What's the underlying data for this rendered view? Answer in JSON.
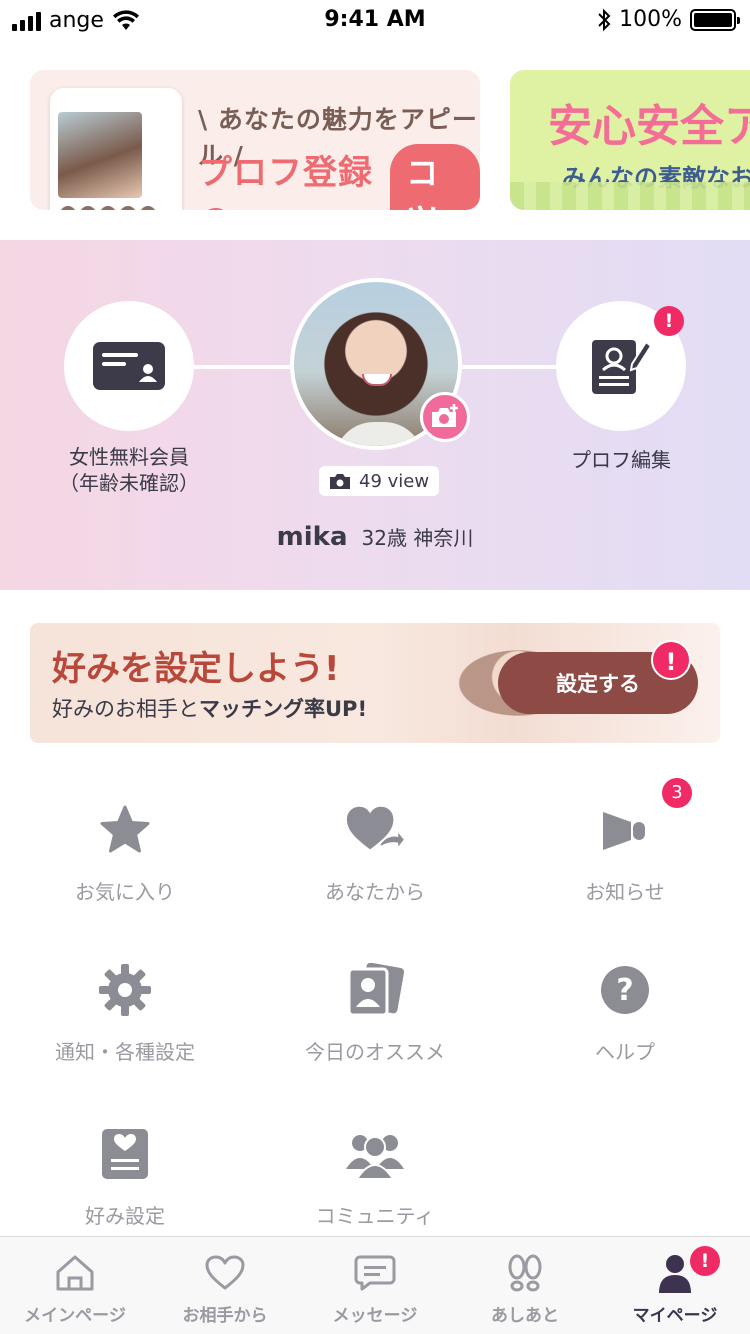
{
  "status_bar": {
    "carrier": "ange",
    "time": "9:41 AM",
    "battery": "100%"
  },
  "banners": {
    "tips": {
      "subtitle": "\\ あなたの魅力をアピール /",
      "title": "プロフ登録の",
      "badge": "コツ"
    },
    "safety": {
      "title": "安心安全ア",
      "subtitle": "みんなの素敵なお"
    }
  },
  "profile": {
    "membership_label": "女性無料会員",
    "membership_status": "（年齢未確認）",
    "edit_label": "プロフ編集",
    "edit_alert": "!",
    "views": "49 view",
    "name": "mika",
    "age_location": "32歳 神奈川"
  },
  "preference": {
    "title": "好みを設定しよう!",
    "sub_plain": "好みのお相手と",
    "sub_bold": "マッチング率UP!",
    "button": "設定する",
    "alert": "!"
  },
  "menu": {
    "favorites": "お気に入り",
    "from_you": "あなたから",
    "notices": "お知らせ",
    "notices_badge": "3",
    "settings": "通知・各種設定",
    "recommend": "今日のオススメ",
    "help": "ヘルプ",
    "pref_settings": "好み設定",
    "community": "コミュニティ"
  },
  "nav": {
    "main": "メインページ",
    "from_partner": "お相手から",
    "message": "メッセージ",
    "footprints": "あしあと",
    "mypage": "マイページ",
    "mypage_alert": "!"
  },
  "colors": {
    "accent_pink": "#f02a64",
    "pref_button": "#8e4a45",
    "icon_gray": "#8c8c94",
    "active_nav": "#3d3350"
  }
}
